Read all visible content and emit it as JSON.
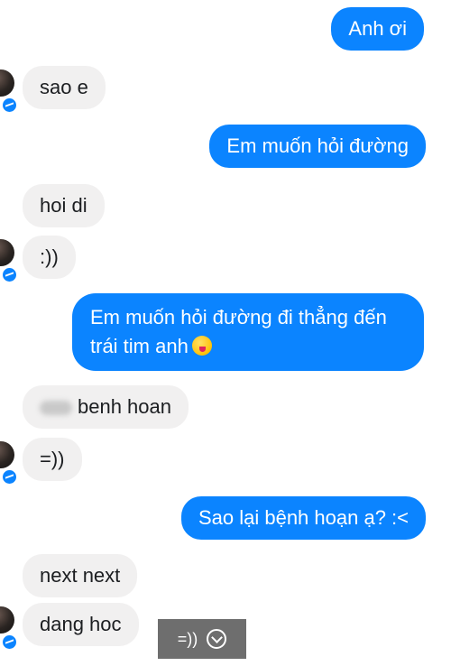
{
  "conversation": {
    "messages": [
      {
        "sender": "me",
        "text": "Anh ơi"
      },
      {
        "sender": "other",
        "text": "sao e"
      },
      {
        "sender": "me",
        "text": "Em muốn hỏi đường"
      },
      {
        "sender": "other",
        "text": "hoi di"
      },
      {
        "sender": "other",
        "text": ":))"
      },
      {
        "sender": "me",
        "text": "Em muốn hỏi đường đi thẳng đến trái tim anh",
        "emoji": "winking-tongue-emoji"
      },
      {
        "sender": "other",
        "text": "benh hoan",
        "redacted_prefix": true
      },
      {
        "sender": "other",
        "text": "=))"
      },
      {
        "sender": "me",
        "text": "Sao lại bệnh hoạn ạ? :<"
      },
      {
        "sender": "other",
        "text": "next next"
      },
      {
        "sender": "other",
        "text": "dang hoc"
      }
    ]
  },
  "toast": {
    "text": "=))",
    "icon": "chevron-down-circle-icon"
  },
  "colors": {
    "outgoing": "#0b84ff",
    "incoming": "#f1f0f0",
    "toast": "#6e6e6e"
  }
}
